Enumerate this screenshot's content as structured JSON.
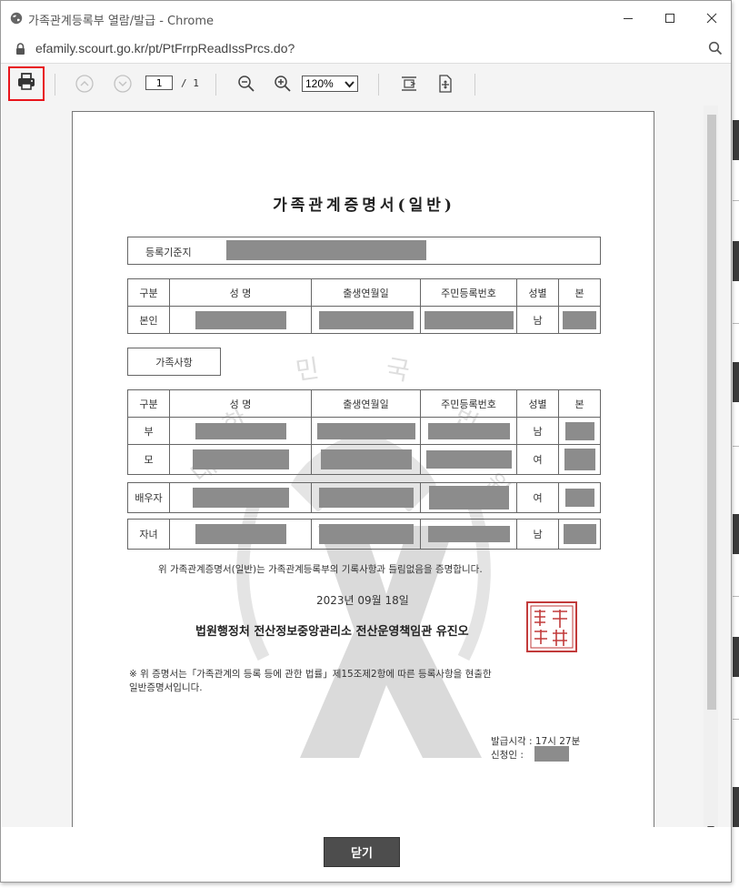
{
  "window": {
    "title": "가족관계등록부 열람/발급 - Chrome",
    "url": "efamily.scourt.go.kr/pt/PtFrrpReadIssPrcs.do?"
  },
  "toolbar": {
    "page_current": "1",
    "page_total": "/ 1",
    "zoom": "120%",
    "highlight_color": "#e8141b"
  },
  "document": {
    "title": "가족관계증명서(일반)",
    "registry_label": "등록기준지",
    "section_self": {
      "headers": [
        "구분",
        "성   명",
        "출생연월일",
        "주민등록번호",
        "성별",
        "본"
      ],
      "rows": [
        {
          "relation": "본인",
          "gender": "남"
        }
      ]
    },
    "family_label": "가족사항",
    "section_family": {
      "headers": [
        "구분",
        "성   명",
        "출생연월일",
        "주민등록번호",
        "성별",
        "본"
      ],
      "rows": [
        {
          "relation": "부",
          "gender": "남"
        },
        {
          "relation": "모",
          "gender": "여"
        },
        {
          "relation": "배우자",
          "gender": "여"
        },
        {
          "relation": "자녀",
          "gender": "남"
        }
      ]
    },
    "certify_text": "위 가족관계증명서(일반)는 가족관계등록부의 기록사항과 틀림없음을 증명합니다.",
    "date": "2023년 09월 18일",
    "issuer": "법원행정처 전산정보중앙관리소 전산운영책임관 유진오",
    "note_line1": "※ 위 증명서는「가족관계의 등록 등에 관한 법률」제15조제2항에 따른 등록사항을 현출한",
    "note_line2": "일반증명서입니다.",
    "issue_time": "발급시각 : 17시 27분",
    "applicant": "신청인 :",
    "watermark_chars": [
      "대",
      "한",
      "민",
      "국",
      "법",
      "원"
    ]
  },
  "footer": {
    "close_label": "닫기"
  }
}
